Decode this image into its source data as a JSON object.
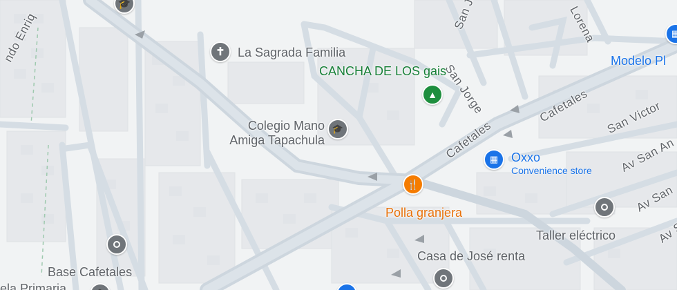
{
  "colors": {
    "background": "#f1f3f4",
    "road": "#d5dde4",
    "road_major": "#cdd6de",
    "block": "#e8eaed",
    "gray_pin": "#70757a",
    "blue": "#1a73e8",
    "orange": "#f57c00",
    "green": "#1e8e3e"
  },
  "streets": {
    "san_jorge": "San Jorge",
    "san_jorge_top": "San Jorge",
    "lorena": "Lorena",
    "cafetales_main": "Cafetales",
    "cafetales_upper": "Cafetales",
    "san_victor": "San Victor",
    "av_san_an": "Av San An",
    "av_san_lower": "Av San",
    "av_s": "Av S",
    "fernando_enriquez": "ndo Enriq"
  },
  "pois": [
    {
      "key": "sagrada_familia",
      "name": "La Sagrada Familia",
      "icon": "cross-icon",
      "color": "gray"
    },
    {
      "key": "cancha",
      "name": "CANCHA DE LOS gais",
      "icon": "tree-icon",
      "color": "green"
    },
    {
      "key": "colegio",
      "name": "Colegio Mano Amiga Tapachula",
      "name_line1": "Colegio Mano",
      "name_line2": "Amiga Tapachula",
      "icon": "school-icon",
      "color": "gray"
    },
    {
      "key": "oxxo",
      "name": "Oxxo",
      "category": "Convenience store",
      "icon": "store-icon",
      "color": "blue"
    },
    {
      "key": "polla",
      "name": "Polla granjera",
      "icon": "restaurant-icon",
      "color": "orange"
    },
    {
      "key": "taller",
      "name": "Taller eléctrico",
      "icon": "pin-icon",
      "color": "gray"
    },
    {
      "key": "casa_jose",
      "name": "Casa de José renta",
      "icon": "pin-icon",
      "color": "gray"
    },
    {
      "key": "base_cafetales",
      "name": "Base Cafetales",
      "icon": "pin-icon",
      "color": "gray"
    },
    {
      "key": "modelo",
      "name": "Modelo Pl",
      "icon": "store-icon",
      "color": "blue"
    },
    {
      "key": "escuela_primaria",
      "name": "uela Primaria",
      "icon": "school-icon",
      "color": "gray"
    }
  ]
}
